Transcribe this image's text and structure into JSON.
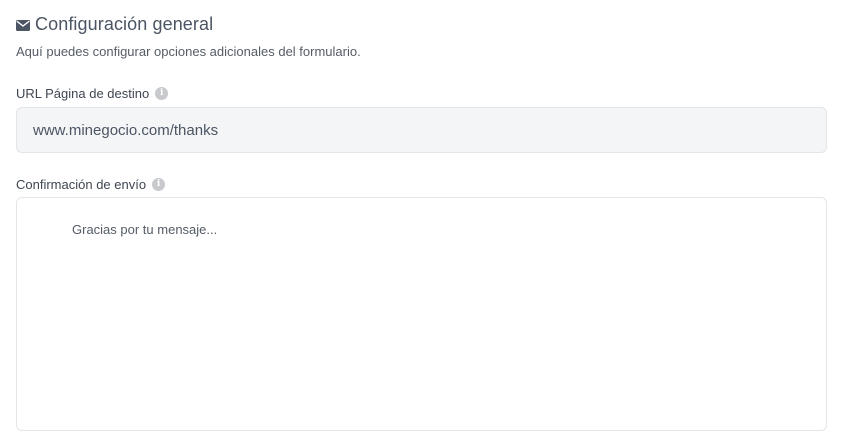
{
  "section": {
    "icon": "envelope-icon",
    "title": "Configuración general",
    "description": "Aquí puedes configurar opciones adicionales del formulario."
  },
  "url_field": {
    "label": "URL Página de destino",
    "info_icon": "info-icon",
    "value": "www.minegocio.com/thanks"
  },
  "confirmation_field": {
    "label": "Confirmación de envío",
    "info_icon": "info-icon",
    "placeholder": "Gracias por tu mensaje..."
  }
}
